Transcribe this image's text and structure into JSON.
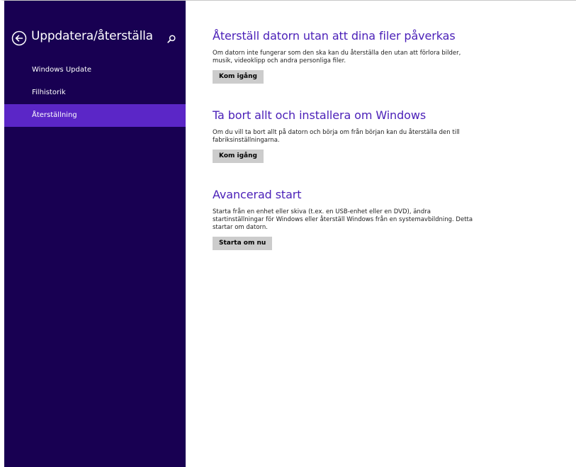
{
  "sidebar": {
    "title": "Uppdatera/återställa",
    "back_icon": "back-arrow-circle-icon",
    "search_icon": "search-icon",
    "items": [
      {
        "label": "Windows Update",
        "selected": false
      },
      {
        "label": "Filhistorik",
        "selected": false
      },
      {
        "label": "Återställning",
        "selected": true
      }
    ]
  },
  "sections": [
    {
      "title": "Återställ datorn utan att dina filer påverkas",
      "description": "Om datorn inte fungerar som den ska kan du återställa den utan att förlora bilder, musik, videoklipp och andra personliga filer.",
      "button_label": "Kom igång"
    },
    {
      "title": "Ta bort allt och installera om Windows",
      "description": "Om du vill ta bort allt på datorn och börja om från början kan du återställa den till fabriksinställningarna.",
      "button_label": "Kom igång"
    },
    {
      "title": "Avancerad start",
      "description": "Starta från en enhet eller skiva (t.ex. en USB-enhet eller en DVD), ändra startinställningar för Windows eller återställ Windows från en systemavbildning. Detta startar om datorn.",
      "button_label": "Starta om nu"
    }
  ],
  "colors": {
    "sidebar_bg": "#180052",
    "selected_item_bg": "#5b26c7",
    "heading_accent": "#4a1fb8",
    "button_bg": "#cccccc"
  }
}
